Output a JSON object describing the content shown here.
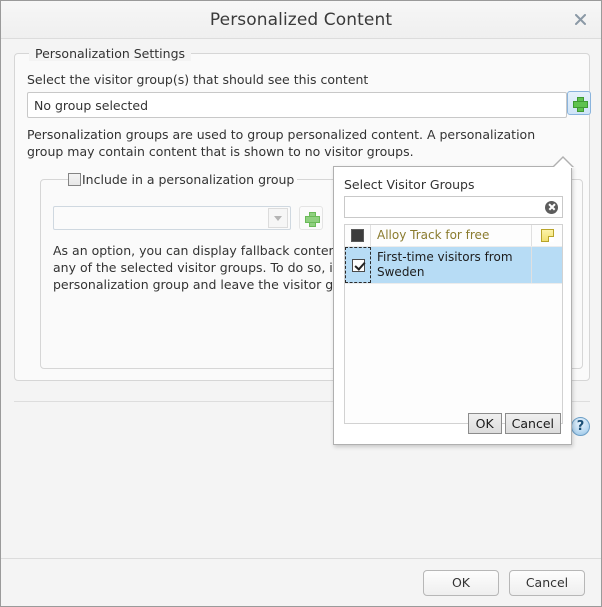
{
  "window": {
    "title": "Personalized Content",
    "close_icon": "close-icon"
  },
  "settings": {
    "legend": "Personalization Settings",
    "select_label": "Select the visitor group(s) that should see this content",
    "selected_value": "No group selected",
    "add_button_icon": "plus-icon",
    "description": "Personalization groups are used to group personalized content. A personalization group may contain content that is shown to no visitor groups."
  },
  "personalization_group": {
    "checkbox_label": "Include in a personalization group",
    "checkbox_checked": false,
    "combo_value": "",
    "combo_arrow_icon": "chevron-down-icon",
    "add_button_icon": "plus-icon",
    "fallback_description": "As an option, you can display fallback content to visitors that do not belong to any of the selected visitor groups. To do so, include the fallback content in a personalization group and leave the visitor group selection field empty."
  },
  "help": {
    "icon": "help-icon",
    "label": "?"
  },
  "footer": {
    "ok": "OK",
    "cancel": "Cancel"
  },
  "visitor_group_popup": {
    "title": "Select Visitor Groups",
    "search_value": "",
    "search_placeholder": "",
    "clear_icon": "clear-icon",
    "rows": [
      {
        "name": "Alloy Track for free",
        "checkbox_state": "filled",
        "selected": false,
        "trailing_icon": "note-icon",
        "has_trailing_icon": true
      },
      {
        "name": "First-time visitors from Sweden",
        "checkbox_state": "checked",
        "selected": true,
        "trailing_icon": "",
        "has_trailing_icon": false
      }
    ],
    "ok": "OK",
    "cancel": "Cancel"
  }
}
